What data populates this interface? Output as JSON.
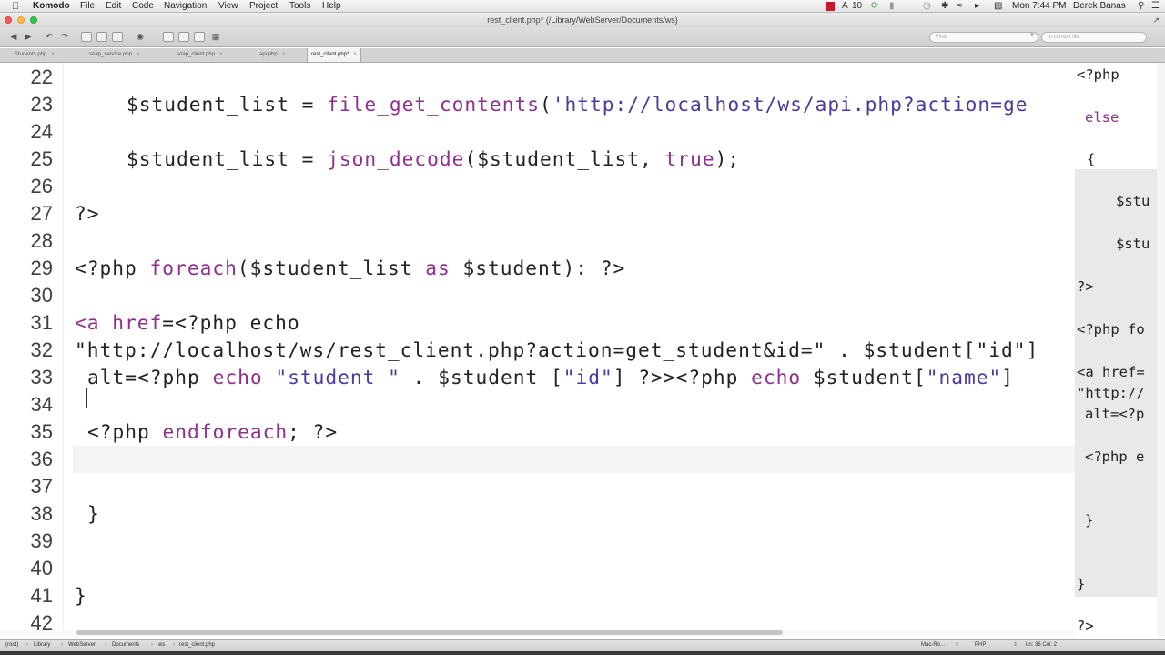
{
  "menubar": {
    "apple_icon": "apple-icon",
    "app": "Komodo",
    "items": [
      "File",
      "Edit",
      "Code",
      "Navigation",
      "View",
      "Project",
      "Tools",
      "Help"
    ],
    "status_count": "10",
    "clock": "Mon 7:44 PM",
    "user": "Derek Banas",
    "record_color": "#c8172a"
  },
  "window": {
    "title": "rest_client.php* (/Library/WebServer/Documents/ws)"
  },
  "toolbar": {
    "find_placeholder": "Find",
    "scope": "In current file"
  },
  "tabs": [
    {
      "label": "Students.php",
      "active": false
    },
    {
      "label": "soap_service.php",
      "active": false
    },
    {
      "label": "soap_client.php",
      "active": false
    },
    {
      "label": "api.php",
      "active": false
    },
    {
      "label": "rest_client.php*",
      "active": true
    }
  ],
  "editor": {
    "line_numbers": [
      "22",
      "23",
      "24",
      "25",
      "26",
      "27",
      "28",
      "29",
      "30",
      "31",
      "32",
      "33",
      "34",
      "35",
      "36",
      "37",
      "38",
      "39",
      "40",
      "41",
      "42"
    ],
    "l23": {
      "a": "$student_list = ",
      "b": "file_get_contents",
      "c": "(",
      "d": "'http://localhost/ws/api.php?action=ge"
    },
    "l25": {
      "a": "$student_list = ",
      "b": "json_decode",
      "c": "($student_list, ",
      "d": "true",
      "e": ");"
    },
    "l27": "?>",
    "l29": {
      "a": "<?php ",
      "b": "foreach",
      "c": "($student_list ",
      "d": "as",
      "e": " $student): ?>"
    },
    "l31": {
      "a": "<a",
      "b": " href",
      "c": "=<?php echo"
    },
    "l32": {
      "a": "\"http://localhost/ws/rest_client.php?action=get_student&id=\"",
      "b": " . $student[",
      "c": "\"id\"",
      "d": "]"
    },
    "l33": {
      "a": "alt=<?php ",
      "b": "echo",
      "c": " ",
      "d": "\"student_\"",
      "e": " . $student_[",
      "f": "\"id\"",
      "g": "] ?>><?php ",
      "h": "echo",
      "i": " $student[",
      "j": "\"name\"",
      "k": "]"
    },
    "l35": {
      "a": "<?php ",
      "b": "endforeach",
      "c": "; ?>"
    },
    "l38": "}",
    "l41": "}"
  },
  "minimap": {
    "lines": [
      "<?php",
      "else",
      "{",
      "$stu",
      "$stu",
      "?>",
      "<?php fo",
      "<a href=",
      "\"http://",
      "alt=<?p",
      "<?php e",
      "}",
      "}",
      "?>"
    ]
  },
  "statusbar": {
    "breadcrumbs": [
      "(root)",
      "Library",
      "WebServer",
      "Documents",
      "ws",
      "rest_client.php"
    ],
    "encoding": "Mac-Ro...",
    "language": "PHP",
    "position": "Ln: 36 Col: 2"
  }
}
